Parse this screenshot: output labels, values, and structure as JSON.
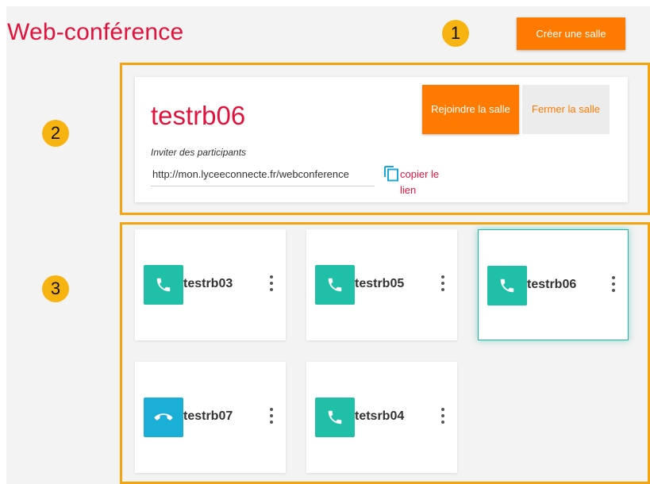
{
  "header": {
    "title": "Web-conférence",
    "create_button": "Créer une salle"
  },
  "callouts": [
    "1",
    "2",
    "3"
  ],
  "room": {
    "name": "testrb06",
    "join_button": "Rejoindre la salle",
    "close_button": "Fermer la salle",
    "invite_label": "Inviter des participants",
    "invite_link": "http://mon.lyceeconnecte.fr/webconference",
    "copy_link": "copier le lien"
  },
  "rooms": [
    {
      "name": "testrb03",
      "icon": "phone-icon",
      "color": "#20c0a8"
    },
    {
      "name": "testrb05",
      "icon": "phone-icon",
      "color": "#20c0a8"
    },
    {
      "name": "testrb06",
      "icon": "phone-icon",
      "color": "#20c0a8",
      "selected": true
    },
    {
      "name": "testrb07",
      "icon": "hang-up-icon",
      "color": "#19afd6"
    },
    {
      "name": "tetsrb04",
      "icon": "phone-icon",
      "color": "#20c0a8"
    }
  ],
  "colors": {
    "accent": "#ff7a00",
    "title_red": "#e3123d",
    "callout": "#f7b310",
    "frame": "#f5a40f"
  }
}
